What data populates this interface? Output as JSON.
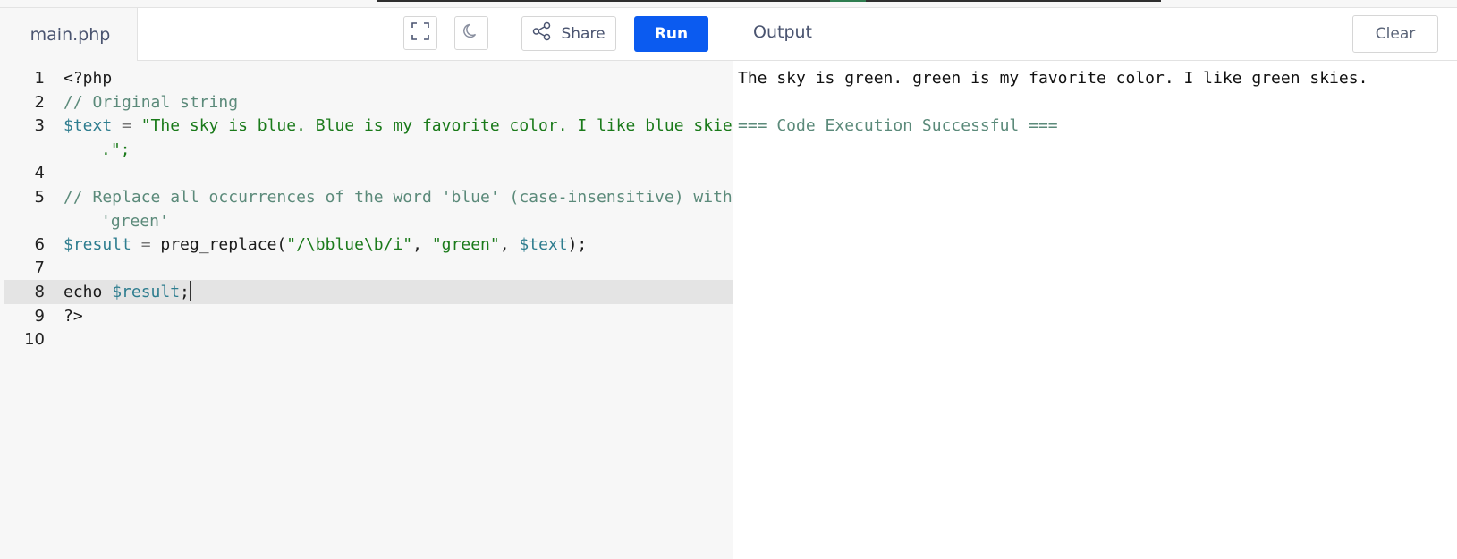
{
  "editor": {
    "file_tab": "main.php",
    "share_label": "Share",
    "run_label": "Run",
    "lines": [
      {
        "num": "1"
      },
      {
        "num": "2"
      },
      {
        "num": "3"
      },
      {
        "num": "4"
      },
      {
        "num": "5"
      },
      {
        "num": "6"
      },
      {
        "num": "7"
      },
      {
        "num": "8"
      },
      {
        "num": "9"
      },
      {
        "num": "10"
      }
    ],
    "code": {
      "l1": "<?php",
      "l2": "// Original string",
      "l3_var": "$text",
      "l3_eq": " = ",
      "l3_str": "\"The sky is blue. Blue is my favorite color. I like blue skies",
      "l3_cont": ".\";",
      "l5": "// Replace all occurrences of the word 'blue' (case-insensitive) with",
      "l5_cont": "'green'",
      "l6_var": "$result",
      "l6_eq": " = ",
      "l6_fn": "preg_replace(",
      "l6_arg1": "\"/\\bblue\\b/i\"",
      "l6_comma1": ", ",
      "l6_arg2": "\"green\"",
      "l6_comma2": ", ",
      "l6_arg3": "$text",
      "l6_end": ");",
      "l8_kw": "echo ",
      "l8_var": "$result",
      "l8_end": ";",
      "l9": "?>"
    }
  },
  "output": {
    "title": "Output",
    "clear_label": "Clear",
    "result": "The sky is green. green is my favorite color. I like green skies.",
    "status": "=== Code Execution Successful ==="
  },
  "colors": {
    "run_button": "#0b5bf0",
    "comment": "#5b8a7a",
    "string": "#1a7a1a",
    "variable": "#2e7d8f"
  },
  "icons": {
    "fullscreen": "fullscreen-icon",
    "theme": "moon-icon",
    "share": "share-icon"
  }
}
